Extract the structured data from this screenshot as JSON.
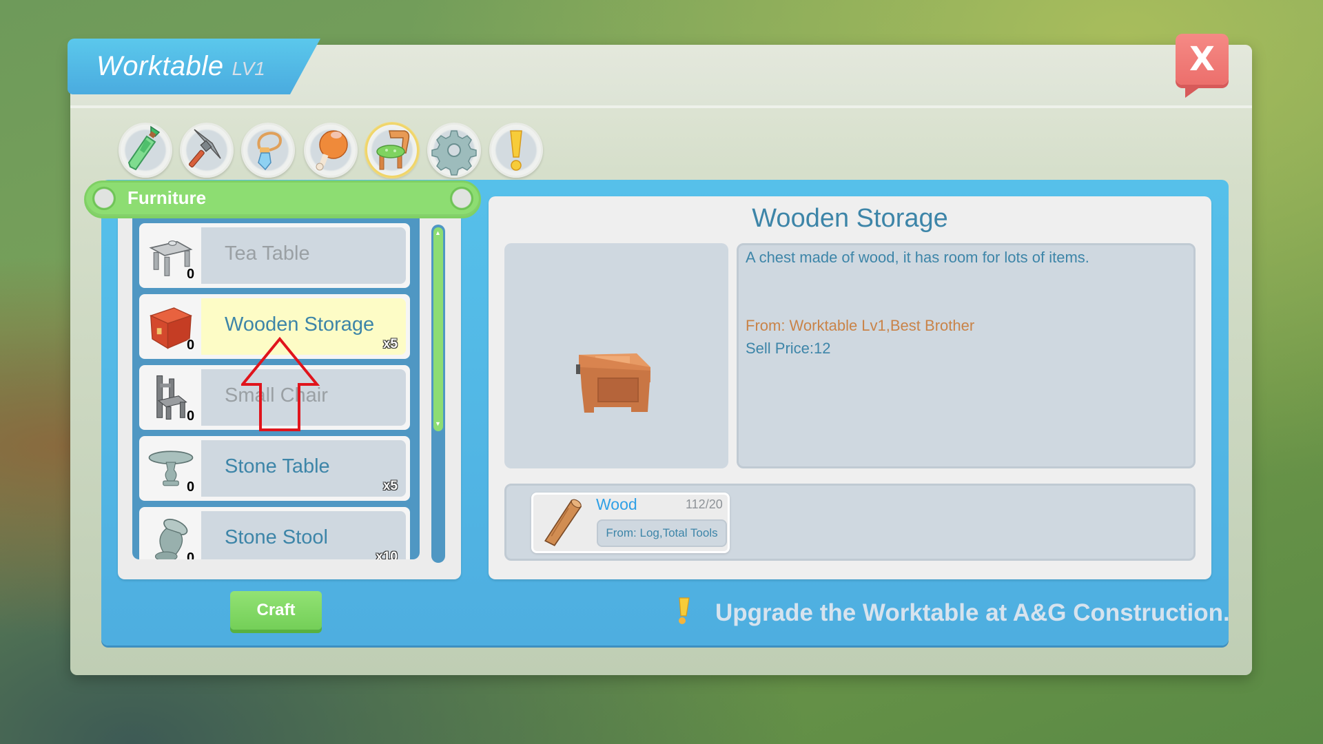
{
  "window": {
    "title": "Worktable",
    "level": "LV1",
    "close_label": "X"
  },
  "category_tabs": [
    {
      "name": "weapons",
      "icon": "sword-icon",
      "active": false
    },
    {
      "name": "tools",
      "icon": "pickaxe-icon",
      "active": false
    },
    {
      "name": "accessories",
      "icon": "amulet-icon",
      "active": false
    },
    {
      "name": "food",
      "icon": "meat-icon",
      "active": false
    },
    {
      "name": "furniture",
      "icon": "chair-icon",
      "active": true
    },
    {
      "name": "parts",
      "icon": "gear-icon",
      "active": false
    },
    {
      "name": "special",
      "icon": "exclamation-icon",
      "active": false
    }
  ],
  "category_header": "Furniture",
  "recipes": [
    {
      "label": "Tea Table",
      "owned": "0",
      "multiplier": "",
      "state": "disabled",
      "icon": "tea-table-icon"
    },
    {
      "label": "Wooden Storage",
      "owned": "0",
      "multiplier": "x5",
      "state": "selected",
      "icon": "wooden-chest-icon"
    },
    {
      "label": "Small Chair",
      "owned": "0",
      "multiplier": "",
      "state": "disabled",
      "icon": "small-chair-icon"
    },
    {
      "label": "Stone Table",
      "owned": "0",
      "multiplier": "x5",
      "state": "available",
      "icon": "stone-table-icon"
    },
    {
      "label": "Stone Stool",
      "owned": "0",
      "multiplier": "x10",
      "state": "available",
      "icon": "stone-stool-icon"
    }
  ],
  "detail": {
    "title": "Wooden Storage",
    "description": "A chest made of wood, it has room for lots of items.",
    "from": "From: Worktable Lv1,Best Brother",
    "sell_price": "Sell Price:12",
    "materials": [
      {
        "name": "Wood",
        "count": "112/20",
        "source": "From: Log,Total Tools",
        "icon": "wood-log-icon"
      }
    ]
  },
  "actions": {
    "craft_label": "Craft"
  },
  "hint": {
    "icon": "lightbulb-icon",
    "text": "Upgrade the Worktable at A&G Construction."
  },
  "colors": {
    "accent_blue": "#4eaee0",
    "accent_green": "#8ddd72",
    "text_blue": "#3d85a8",
    "source_orange": "#c98348",
    "selected_row": "#fdfcc6",
    "close_red": "#ec6f6c"
  }
}
